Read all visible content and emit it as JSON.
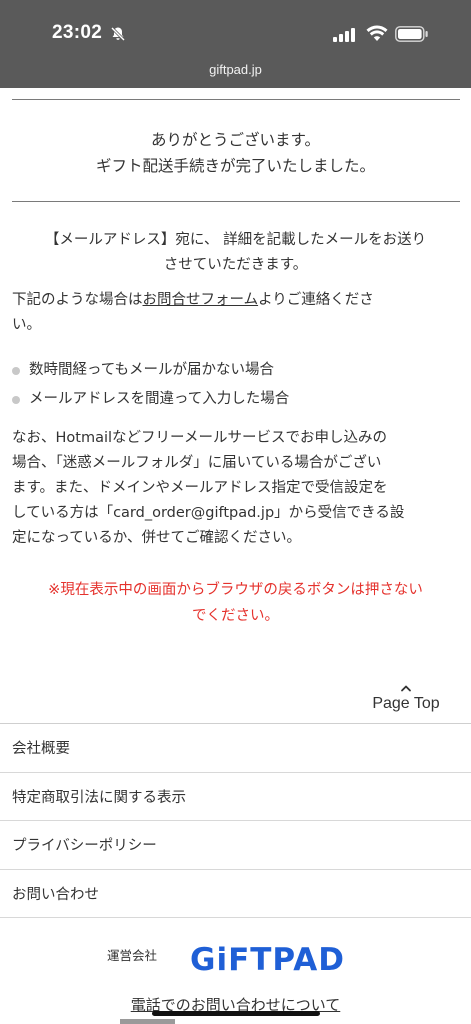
{
  "status_bar": {
    "time": "23:02",
    "url": "giftpad.jp"
  },
  "thanks": {
    "line1": "ありがとうございます。",
    "line2": "ギフト配送手続きが完了いたしました。"
  },
  "notice": {
    "email_line1": "【メールアドレス】宛に、 詳細を記載したメールをお送り",
    "email_line2": "させていただきます。",
    "contact_before": "下記のような場合は",
    "contact_link": "お問合せフォーム",
    "contact_after": "よりご連絡くださ",
    "contact_line2": "い。",
    "bullets": [
      "数時間経ってもメールが届かない場合",
      "メールアドレスを間違って入力した場合"
    ],
    "spam_lines": [
      "なお、Hotmailなどフリーメールサービスでお申し込みの",
      "場合、「迷惑メールフォルダ」に届いている場合がござい",
      "ます。また、ドメインやメールアドレス指定で受信設定を",
      "している方は「card_order@giftpad.jp」から受信できる設",
      "定になっているか、併せてご確認ください。"
    ],
    "warning_line1": "※現在表示中の画面からブラウザの戻るボタンは押さない",
    "warning_line2": "でください。"
  },
  "page_top": {
    "label": "Page Top"
  },
  "footer": {
    "nav": [
      "会社概要",
      "特定商取引法に関する表示",
      "プライバシーポリシー",
      "お問い合わせ"
    ],
    "operator_label": "運営会社",
    "logo_text": "GiFTPAD",
    "phone_link": "電話でのお問い合わせについて"
  },
  "colors": {
    "status_bar_bg": "#5a5a5a",
    "warning": "#e5322d",
    "logo_blue": "#1f5fd6"
  }
}
